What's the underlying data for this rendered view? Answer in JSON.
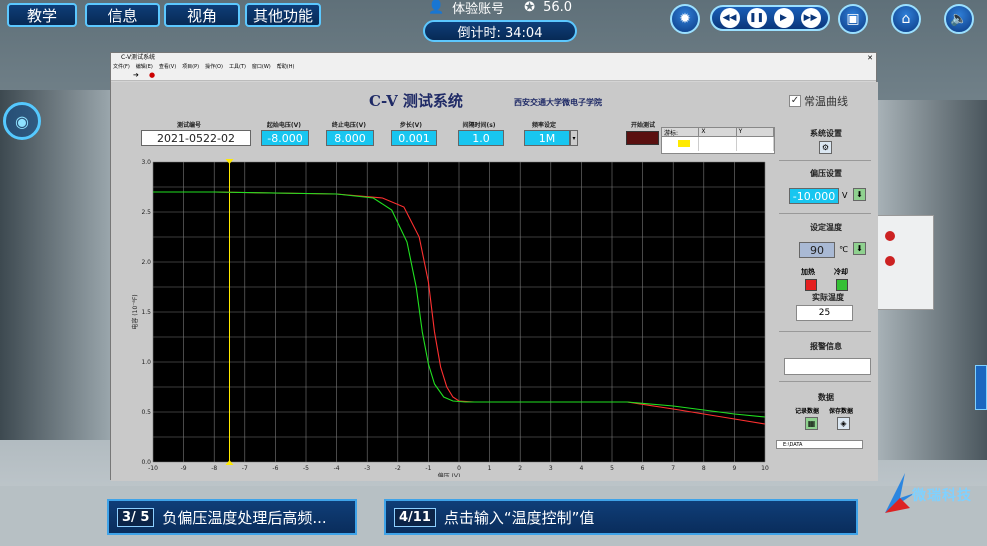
{
  "nav": [
    "教学",
    "信息",
    "视角",
    "其他功能"
  ],
  "account": {
    "label": "体验账号",
    "score": "56.0"
  },
  "timer": "倒计时: 34:04",
  "window": {
    "title": "C-V测试系统",
    "menu": [
      "文件(F)",
      "编辑(E)",
      "查看(V)",
      "项目(P)",
      "操作(O)",
      "工具(T)",
      "窗口(W)",
      "帮助(H)"
    ]
  },
  "system": {
    "title": "C-V 测试系统",
    "school": "西安交通大学微电子学院"
  },
  "constant_temp": {
    "label": "常温曲线",
    "checked": "✓"
  },
  "fields": {
    "test_id": {
      "label": "测试编号",
      "value": "2021-0522-02"
    },
    "start_v": {
      "label": "起始电压(V)",
      "value": "-8.000"
    },
    "end_v": {
      "label": "终止电压(V)",
      "value": "8.000"
    },
    "step": {
      "label": "步长(V)",
      "value": "0.001"
    },
    "interval": {
      "label": "间隔时间(s)",
      "value": "1.0"
    },
    "freq": {
      "label": "频率设定",
      "value": "1M"
    },
    "start": {
      "label": "开始测试"
    }
  },
  "cursor_table": {
    "h0": "游标:",
    "h1": "X",
    "h2": "Y"
  },
  "right": {
    "sys_settings": "系统设置",
    "bias_settings": "偏压设置",
    "bias_value": "-10.000",
    "bias_unit": "V",
    "temp_settings": "设定温度",
    "temp_value": "90",
    "temp_unit": "℃",
    "heat": "加热",
    "cool": "冷却",
    "actual_temp": "实际温度",
    "actual_value": "25",
    "alarm": "报警信息",
    "data": "数据",
    "record": "记录数据",
    "save": "保存数据",
    "path": "E:\\DATA"
  },
  "chart_data": {
    "type": "line",
    "xlabel": "偏压 (V)",
    "ylabel": "电容 (10⁻⁶F)",
    "xlim": [
      -10,
      10
    ],
    "ylim": [
      0,
      3.0
    ],
    "xticks": [
      -10,
      -9,
      -8,
      -7,
      -6,
      -5,
      -4,
      -3,
      -2,
      -1,
      0,
      1,
      2,
      3,
      4,
      5,
      6,
      7,
      8,
      9,
      10
    ],
    "yticks": [
      0.0,
      0.5,
      1.0,
      1.5,
      2.0,
      2.5,
      3.0
    ],
    "cursor_x": -7.5,
    "series": [
      {
        "color": "#ff3030",
        "x": [
          -10,
          -8,
          -4,
          -2.5,
          -1.8,
          -1.3,
          -1.0,
          -0.8,
          -0.6,
          -0.4,
          -0.2,
          0,
          0.5,
          1,
          3,
          5.5,
          7,
          8,
          9,
          10
        ],
        "y": [
          2.7,
          2.7,
          2.68,
          2.64,
          2.55,
          2.25,
          1.8,
          1.3,
          0.95,
          0.75,
          0.65,
          0.61,
          0.6,
          0.6,
          0.6,
          0.6,
          0.53,
          0.48,
          0.43,
          0.38
        ]
      },
      {
        "color": "#20e020",
        "x": [
          -10,
          -8,
          -4,
          -2.8,
          -2.2,
          -1.7,
          -1.4,
          -1.2,
          -1.0,
          -0.8,
          -0.5,
          -0.2,
          0.2,
          0.8,
          3,
          5.5,
          7,
          8,
          9,
          10
        ],
        "y": [
          2.7,
          2.7,
          2.68,
          2.64,
          2.52,
          2.2,
          1.75,
          1.3,
          0.98,
          0.78,
          0.65,
          0.61,
          0.6,
          0.6,
          0.6,
          0.6,
          0.56,
          0.52,
          0.48,
          0.45
        ]
      }
    ]
  },
  "tasks": [
    {
      "badge": "3/ 5",
      "text": "负偏压温度处理后高频..."
    },
    {
      "badge": "4/11",
      "text": "点击输入“温度控制”值"
    }
  ],
  "logo": "微瑞科技"
}
